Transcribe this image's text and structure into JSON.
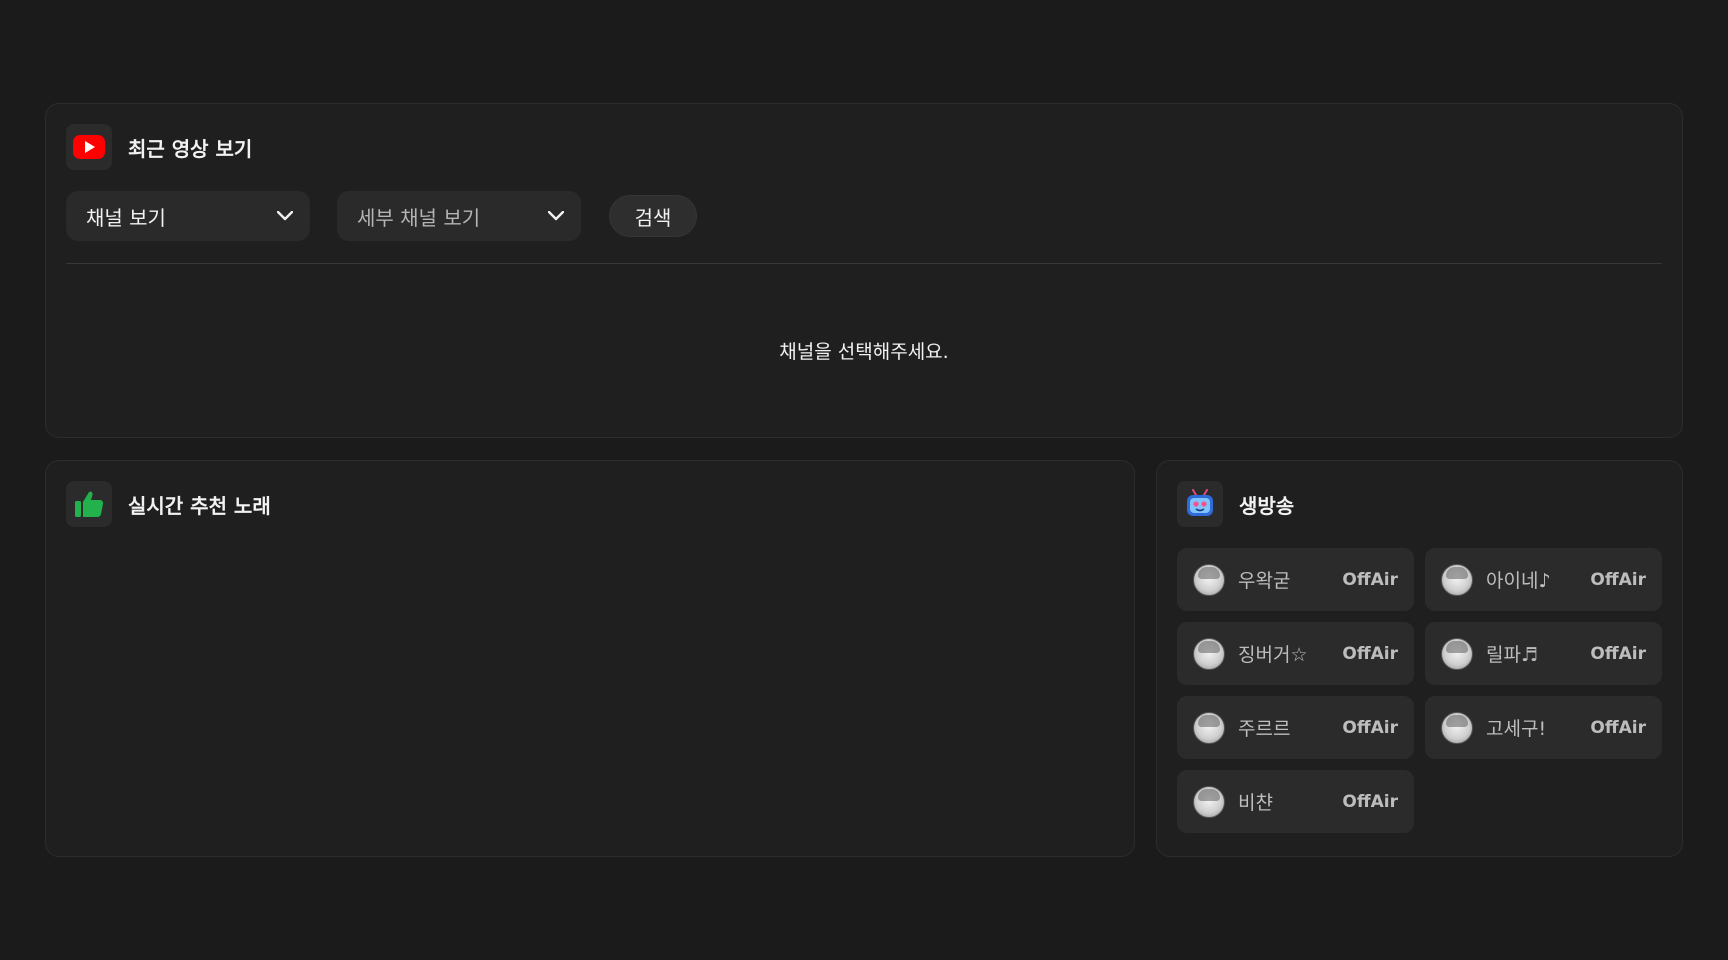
{
  "recent": {
    "title": "최근 영상 보기",
    "channel_select": "채널 보기",
    "sub_channel_select": "세부 채널 보기",
    "search_label": "검색",
    "empty_message": "채널을 선택해주세요."
  },
  "recommend": {
    "title": "실시간 추천 노래"
  },
  "live": {
    "title": "생방송",
    "items": [
      {
        "name": "우왁굳",
        "status": "OffAir"
      },
      {
        "name": "아이네♪",
        "status": "OffAir"
      },
      {
        "name": "징버거☆",
        "status": "OffAir"
      },
      {
        "name": "릴파♬",
        "status": "OffAir"
      },
      {
        "name": "주르르",
        "status": "OffAir"
      },
      {
        "name": "고세구!",
        "status": "OffAir"
      },
      {
        "name": "비챤",
        "status": "OffAir"
      }
    ]
  },
  "colors": {
    "background": "#1b1b1b",
    "card": "#1f1f1f",
    "youtube_red": "#ff0000",
    "thumbs_green": "#22b14c"
  },
  "icons": {
    "recent": "youtube-icon",
    "recommend": "thumbs-up-icon",
    "live": "tv-mascot-icon"
  }
}
